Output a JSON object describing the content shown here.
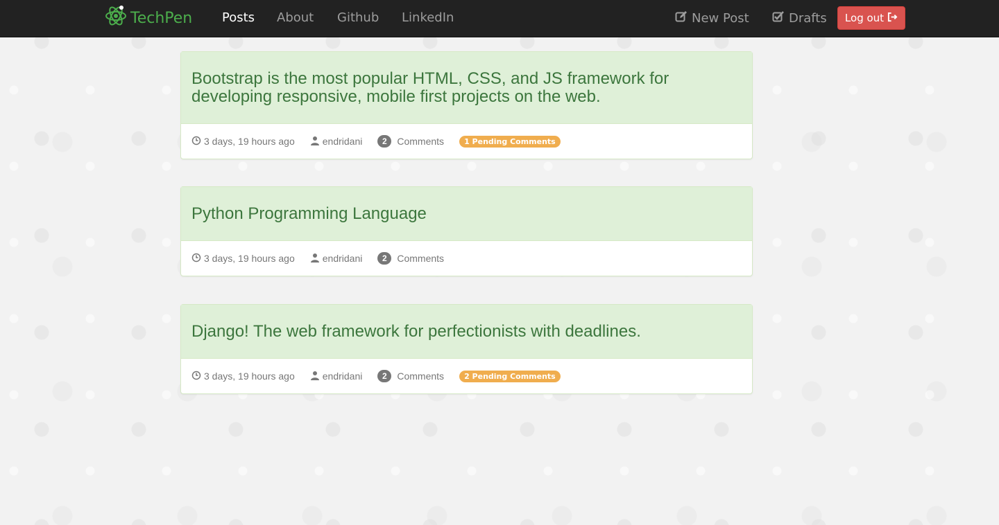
{
  "navbar": {
    "brand": "TechPen",
    "links": [
      {
        "label": "Posts",
        "active": true
      },
      {
        "label": "About",
        "active": false
      },
      {
        "label": "Github",
        "active": false
      },
      {
        "label": "LinkedIn",
        "active": false
      }
    ],
    "new_post": "New Post",
    "drafts": "Drafts",
    "logout": "Log out"
  },
  "posts": [
    {
      "title": "Bootstrap is the most popular HTML, CSS, and JS framework for developing responsive, mobile first projects on the web.",
      "time": "3 days, 19 hours ago",
      "author": "endridani",
      "comment_count": "2",
      "comments_label": "Comments",
      "pending": "1 Pending Comments"
    },
    {
      "title": "Python Programming Language",
      "time": "3 days, 19 hours ago",
      "author": "endridani",
      "comment_count": "2",
      "comments_label": "Comments",
      "pending": ""
    },
    {
      "title": "Django! The web framework for perfectionists with deadlines.",
      "time": "3 days, 19 hours ago",
      "author": "endridani",
      "comment_count": "2",
      "comments_label": "Comments",
      "pending": "2 Pending Comments"
    }
  ],
  "colors": {
    "navbar_bg": "#222222",
    "brand_green": "#4cae4c",
    "panel_heading_bg": "#dff0d8",
    "panel_heading_text": "#3c763d",
    "logout_bg": "#d9534f",
    "pending_badge": "#f0ad4e"
  }
}
